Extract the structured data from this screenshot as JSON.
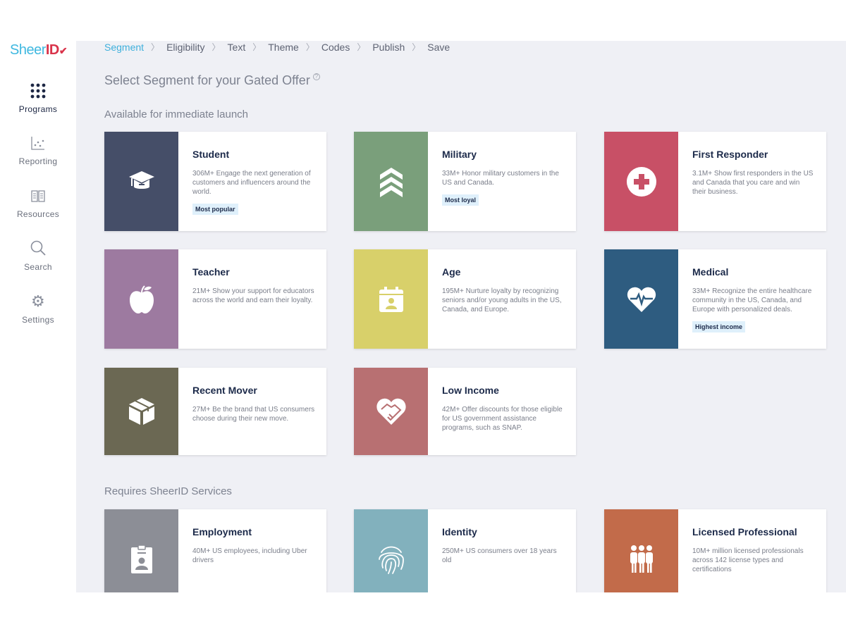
{
  "logo": {
    "part1": "Sheer",
    "part2": "ID"
  },
  "nav": [
    {
      "label": "Programs",
      "icon": "grid-icon"
    },
    {
      "label": "Reporting",
      "icon": "scatter-chart-icon"
    },
    {
      "label": "Resources",
      "icon": "book-icon"
    },
    {
      "label": "Search",
      "icon": "search-icon"
    },
    {
      "label": "Settings",
      "icon": "gear-icon"
    }
  ],
  "breadcrumb": [
    "Segment",
    "Eligibility",
    "Text",
    "Theme",
    "Codes",
    "Publish",
    "Save"
  ],
  "heading": "Select Segment for your Gated Offer",
  "help": "?",
  "sections": {
    "immediate": "Available for immediate launch",
    "services": "Requires SheerID Services"
  },
  "cards": [
    {
      "title": "Student",
      "desc": "306M+ Engage the next generation of customers and influencers around the world.",
      "badge": "Most popular",
      "color": "#454e68",
      "icon": "graduation-cap-icon"
    },
    {
      "title": "Military",
      "desc": "33M+ Honor military customers in the US and Canada.",
      "badge": "Most loyal",
      "color": "#7a9f7b",
      "icon": "chevrons-icon"
    },
    {
      "title": "First Responder",
      "desc": "3.1M+ Show first responders in the US and Canada that you care and win their business.",
      "badge": "",
      "color": "#c85066",
      "icon": "medical-cross-icon"
    },
    {
      "title": "Teacher",
      "desc": "21M+ Show your support for educators across the world and earn their loyalty.",
      "badge": "",
      "color": "#9d7aa0",
      "icon": "apple-icon"
    },
    {
      "title": "Age",
      "desc": "195M+ Nurture loyalty by recognizing seniors and/or young adults in the US, Canada, and Europe.",
      "badge": "",
      "color": "#d8d06a",
      "icon": "calendar-person-icon"
    },
    {
      "title": "Medical",
      "desc": "33M+ Recognize the entire healthcare community in the US, Canada, and Europe with personalized deals.",
      "badge": "Highest income",
      "color": "#2e5c80",
      "icon": "heart-pulse-icon"
    },
    {
      "title": "Recent Mover",
      "desc": "27M+ Be the brand that US consumers choose during their new move.",
      "badge": "",
      "color": "#6b6853",
      "icon": "box-icon"
    },
    {
      "title": "Low Income",
      "desc": "42M+ Offer discounts for those eligible for US government assistance programs, such as SNAP.",
      "badge": "",
      "color": "#b87072",
      "icon": "heart-handshake-icon"
    },
    {
      "title": "Employment",
      "desc": "40M+ US employees, including Uber drivers",
      "badge": "",
      "color": "#8c8e96",
      "icon": "id-badge-icon"
    },
    {
      "title": "Identity",
      "desc": "250M+ US consumers over 18 years old",
      "badge": "",
      "color": "#82b1bd",
      "icon": "fingerprint-icon"
    },
    {
      "title": "Licensed Professional",
      "desc": "10M+ million licensed professionals across 142 license types and certifications",
      "badge": "",
      "color": "#c26b4a",
      "icon": "people-group-icon"
    }
  ]
}
